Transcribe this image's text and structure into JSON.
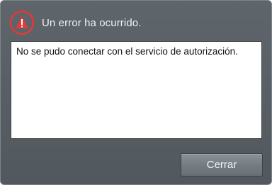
{
  "dialog": {
    "title": "Un error ha ocurrido.",
    "icon": "error-triangle-icon",
    "message": "No se pudo conectar con el servicio de autorización.",
    "close_label": "Cerrar",
    "colors": {
      "icon_red": "#e03a3a",
      "background": "#555c62",
      "button": "#747b81"
    }
  }
}
